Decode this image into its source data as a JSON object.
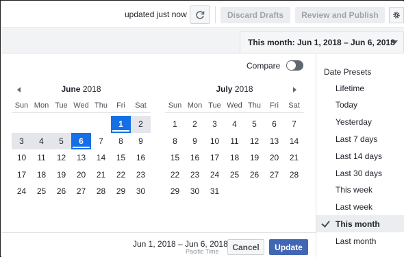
{
  "toolbar": {
    "updated_text": "updated just now",
    "discard_label": "Discard Drafts",
    "review_label": "Review and Publish",
    "refresh_icon": "refresh-icon",
    "settings_icon": "gear-icon"
  },
  "range_select": {
    "label": "This month: Jun 1, 2018 – Jun 6, 2018"
  },
  "compare": {
    "label": "Compare",
    "enabled": false
  },
  "calendar": {
    "weekdays": [
      "Sun",
      "Mon",
      "Tue",
      "Wed",
      "Thu",
      "Fri",
      "Sat"
    ],
    "months": [
      {
        "month_name": "June",
        "year": "2018",
        "first_weekday": 5,
        "days_in_month": 30,
        "selected_days": [
          1,
          6
        ],
        "range_days": [
          2,
          3,
          4,
          5
        ]
      },
      {
        "month_name": "July",
        "year": "2018",
        "first_weekday": 0,
        "days_in_month": 31,
        "selected_days": [],
        "range_days": []
      }
    ]
  },
  "footer": {
    "range_text": "Jun 1, 2018 – Jun 6, 2018",
    "timezone": "Pacific Time",
    "cancel_label": "Cancel",
    "update_label": "Update"
  },
  "presets": {
    "title": "Date Presets",
    "items": [
      {
        "label": "Lifetime",
        "active": false
      },
      {
        "label": "Today",
        "active": false
      },
      {
        "label": "Yesterday",
        "active": false
      },
      {
        "label": "Last 7 days",
        "active": false
      },
      {
        "label": "Last 14 days",
        "active": false
      },
      {
        "label": "Last 30 days",
        "active": false
      },
      {
        "label": "This week",
        "active": false
      },
      {
        "label": "Last week",
        "active": false
      },
      {
        "label": "This month",
        "active": true
      },
      {
        "label": "Last month",
        "active": false
      }
    ]
  },
  "colors": {
    "accent": "#166fe5",
    "update_button": "#4267b2",
    "range_highlight": "#e4e6eb"
  }
}
